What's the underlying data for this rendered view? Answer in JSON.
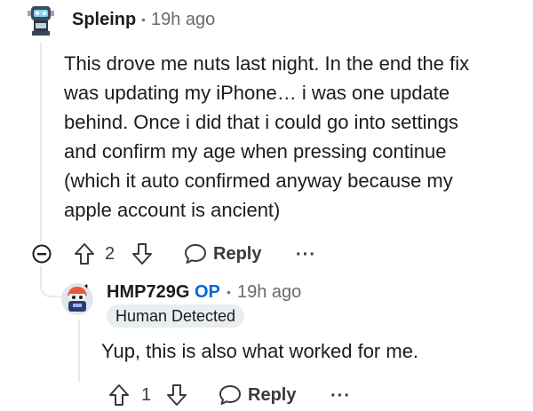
{
  "comment": {
    "username": "Spleinp",
    "separator": "•",
    "time": "19h ago",
    "body": "This drove me nuts last night. In the end the fix\nwas updating my iPhone… i was one update\nbehind. Once i did that i could go into settings\nand confirm my age when pressing continue\n(which it auto confirmed anyway because my\napple account is ancient)",
    "vote_count": "2",
    "reply_label": "Reply",
    "more_label": "···"
  },
  "reply": {
    "username": "HMP729G",
    "op_label": "OP",
    "separator": "•",
    "time": "19h ago",
    "flair": "Human Detected",
    "body": "Yup, this is also what worked for me.",
    "vote_count": "1",
    "reply_label": "Reply",
    "more_label": "···"
  },
  "colors": {
    "op": "#0a66d6",
    "flair_bg": "#e9eef1",
    "thread_line": "#e5ebee"
  }
}
